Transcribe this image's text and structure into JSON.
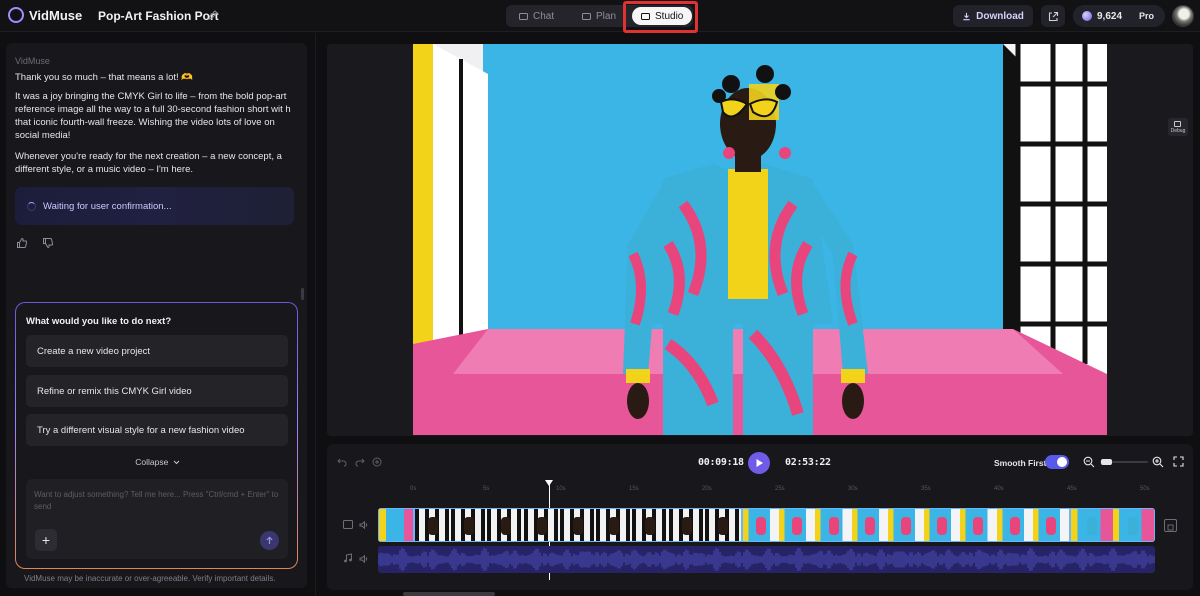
{
  "header": {
    "app_name": "VidMuse",
    "project_title": "Pop-Art Fashion Port",
    "tabs": [
      {
        "label": "Chat",
        "active": false
      },
      {
        "label": "Plan",
        "active": false
      },
      {
        "label": "Studio",
        "active": true
      }
    ],
    "download_label": "Download",
    "credits": "9,624",
    "plan_badge": "Pro",
    "accent_color": "#6f5be8",
    "highlight_color": "#e03232"
  },
  "chat": {
    "sender": "VidMuse",
    "message_1": "Thank you so much – that means a lot! 🫶",
    "message_2": "It was a joy bringing the CMYK Girl to life – from the bold pop-art reference image all the way to a full 30-second fashion short wit h that iconic fourth-wall freeze. Wishing the video lots of love on social media!",
    "message_3": "Whenever you're ready for the next creation – a new concept, a different style, or a music video – I'm here.",
    "status": "Waiting for user confirmation...",
    "prompt_question": "What would you like to do next?",
    "options": [
      "Create a new video project",
      "Refine or remix this CMYK Girl video",
      "Try a different visual style for a new fashion video"
    ],
    "collapse_label": "Collapse",
    "input_placeholder": "Want to adjust something? Tell me here... Press \"Ctrl/cmd + Enter\" to send",
    "disclaimer": "VidMuse may be inaccurate or over-agreeable. Verify important details."
  },
  "preview": {
    "debug_label": "Debug"
  },
  "timeline": {
    "current_time": "00:09:18",
    "total_time": "02:53:22",
    "smooth_first_label": "Smooth First",
    "smooth_first_on": true,
    "ruler_labels": [
      "0s",
      "5s",
      "10s",
      "15s",
      "20s",
      "25s",
      "30s",
      "35s",
      "40s",
      "45s",
      "50s"
    ]
  }
}
